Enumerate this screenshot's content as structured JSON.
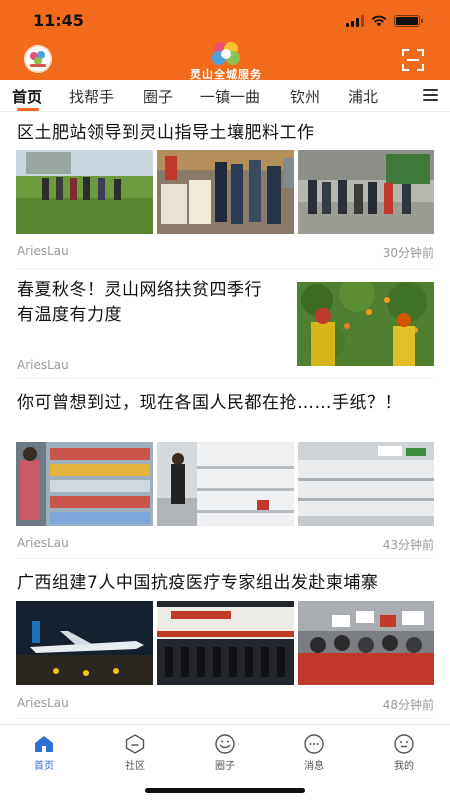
{
  "status_bar": {
    "time": "11:45"
  },
  "header": {
    "app_title": "灵山全城服务"
  },
  "tabs": [
    {
      "label": "首页",
      "active": true
    },
    {
      "label": "找帮手"
    },
    {
      "label": "圈子"
    },
    {
      "label": "一镇一曲"
    },
    {
      "label": "钦州"
    },
    {
      "label": "浦北"
    }
  ],
  "feed": [
    {
      "title": "区土肥站领导到灵山指导土壤肥料工作",
      "author": "AriesLau",
      "time": "30分钟前"
    },
    {
      "title": "春夏秋冬！灵山网络扶贫四季行有温度有力度",
      "author": "AriesLau",
      "time": ""
    },
    {
      "title": "你可曾想到过，现在各国人民都在抢……手纸？！",
      "author": "AriesLau",
      "time": "43分钟前"
    },
    {
      "title": "广西组建7人中国抗疫医疗专家组出发赴柬埔寨",
      "author": "AriesLau",
      "time": "48分钟前"
    }
  ],
  "bottom_nav": [
    {
      "label": "首页",
      "icon": "home-icon",
      "active": true
    },
    {
      "label": "社区",
      "icon": "community-icon"
    },
    {
      "label": "圈子",
      "icon": "circle-icon"
    },
    {
      "label": "消息",
      "icon": "message-icon"
    },
    {
      "label": "我的",
      "icon": "profile-icon"
    }
  ],
  "colors": {
    "brand_orange": "#f26b1d",
    "active_blue": "#2f6fd8",
    "meta_gray": "#9a9a9a"
  }
}
